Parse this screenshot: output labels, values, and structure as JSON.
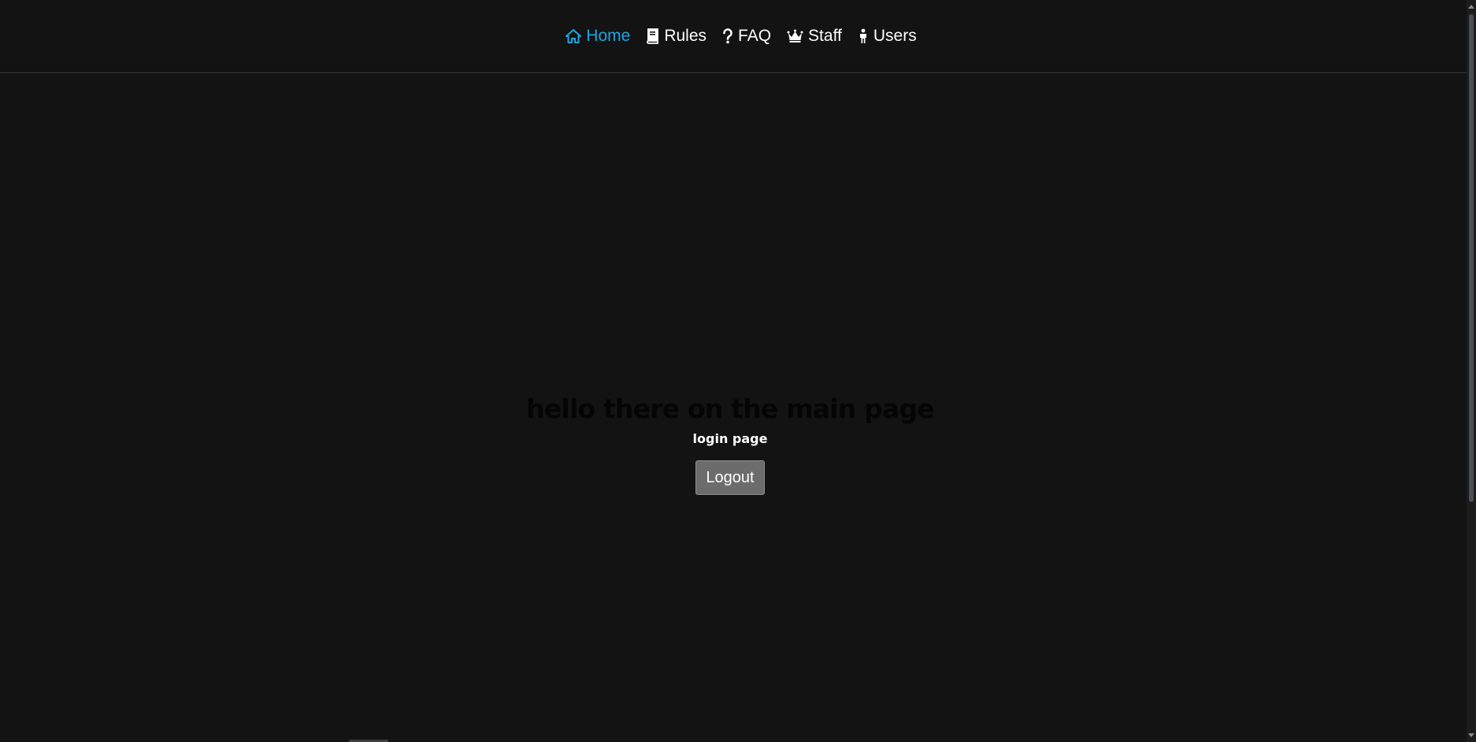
{
  "nav": {
    "items": [
      {
        "label": "Home",
        "icon": "home-icon",
        "active": true
      },
      {
        "label": "Rules",
        "icon": "book-icon",
        "active": false
      },
      {
        "label": "FAQ",
        "icon": "question-icon",
        "active": false
      },
      {
        "label": "Staff",
        "icon": "crown-icon",
        "active": false
      },
      {
        "label": "Users",
        "icon": "person-icon",
        "active": false
      }
    ]
  },
  "main": {
    "title": "hello there on the main page",
    "subtitle": "login page",
    "logout_label": "Logout"
  },
  "colors": {
    "background": "#131313",
    "active_nav": "#1aa6e3",
    "nav_text": "#ffffff",
    "button_bg": "#6c6c6c"
  }
}
